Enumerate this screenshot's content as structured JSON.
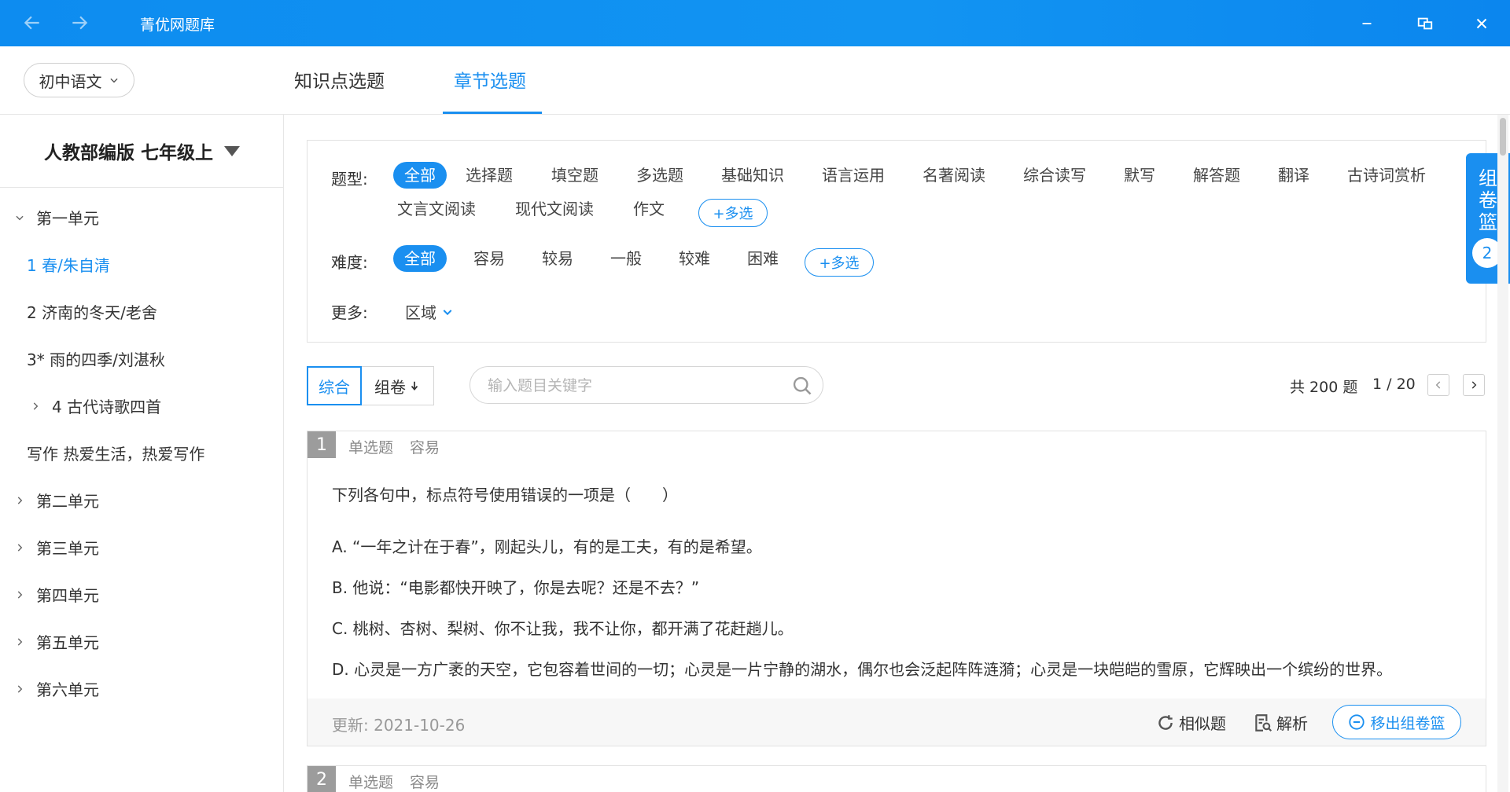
{
  "app": {
    "title": "菁优网题库"
  },
  "header": {
    "subject": "初中语文",
    "tabs": [
      {
        "label": "知识点选题"
      },
      {
        "label": "章节选题"
      }
    ]
  },
  "sidebar": {
    "book_title": "人教部编版 七年级上",
    "items": [
      {
        "label": "第一单元"
      },
      {
        "label": "1 春/朱自清"
      },
      {
        "label": "2 济南的冬天/老舍"
      },
      {
        "label": "3* 雨的四季/刘湛秋"
      },
      {
        "label": "4 古代诗歌四首"
      },
      {
        "label": "写作 热爱生活，热爱写作"
      },
      {
        "label": "第二单元"
      },
      {
        "label": "第三单元"
      },
      {
        "label": "第四单元"
      },
      {
        "label": "第五单元"
      },
      {
        "label": "第六单元"
      }
    ]
  },
  "filters": {
    "type_label": "题型:",
    "types": [
      "全部",
      "选择题",
      "填空题",
      "多选题",
      "基础知识",
      "语言运用",
      "名著阅读",
      "综合读写",
      "默写",
      "解答题",
      "翻译",
      "古诗词赏析",
      "文言文阅读",
      "现代文阅读",
      "作文"
    ],
    "multi_label": "+多选",
    "difficulty_label": "难度:",
    "difficulties": [
      "全部",
      "容易",
      "较易",
      "一般",
      "较难",
      "困难"
    ],
    "more_label": "更多:",
    "region_label": "区域"
  },
  "toolbar": {
    "sort_comprehensive": "综合",
    "sort_paper": "组卷",
    "search_placeholder": "输入题目关键字",
    "total": "共 200 题",
    "page": "1 / 20"
  },
  "questions": [
    {
      "number": "1",
      "type": "单选题",
      "difficulty": "容易",
      "stem": "下列各句中，标点符号使用错误的一项是（　　）",
      "options": [
        "A. “一年之计在于春”，刚起头儿，有的是工夫，有的是希望。",
        "B. 他说：“电影都快开映了，你是去呢？还是不去？”",
        "C. 桃树、杏树、梨树、你不让我，我不让你，都开满了花赶趟儿。",
        "D. 心灵是一方广袤的天空，它包容着世间的一切；心灵是一片宁静的湖水，偶尔也会泛起阵阵涟漪；心灵是一块皑皑的雪原，它辉映出一个缤纷的世界。"
      ],
      "updated": "更新: 2021-10-26",
      "similar_label": "相似题",
      "analysis_label": "解析",
      "remove_label": "移出组卷篮"
    },
    {
      "number": "2",
      "type": "单选题",
      "difficulty": "容易"
    }
  ],
  "basket": {
    "chars": [
      "组",
      "卷",
      "篮"
    ],
    "count": "2"
  },
  "colors": {
    "accent": "#1a8ff0",
    "titlebar": "#1294f2"
  }
}
